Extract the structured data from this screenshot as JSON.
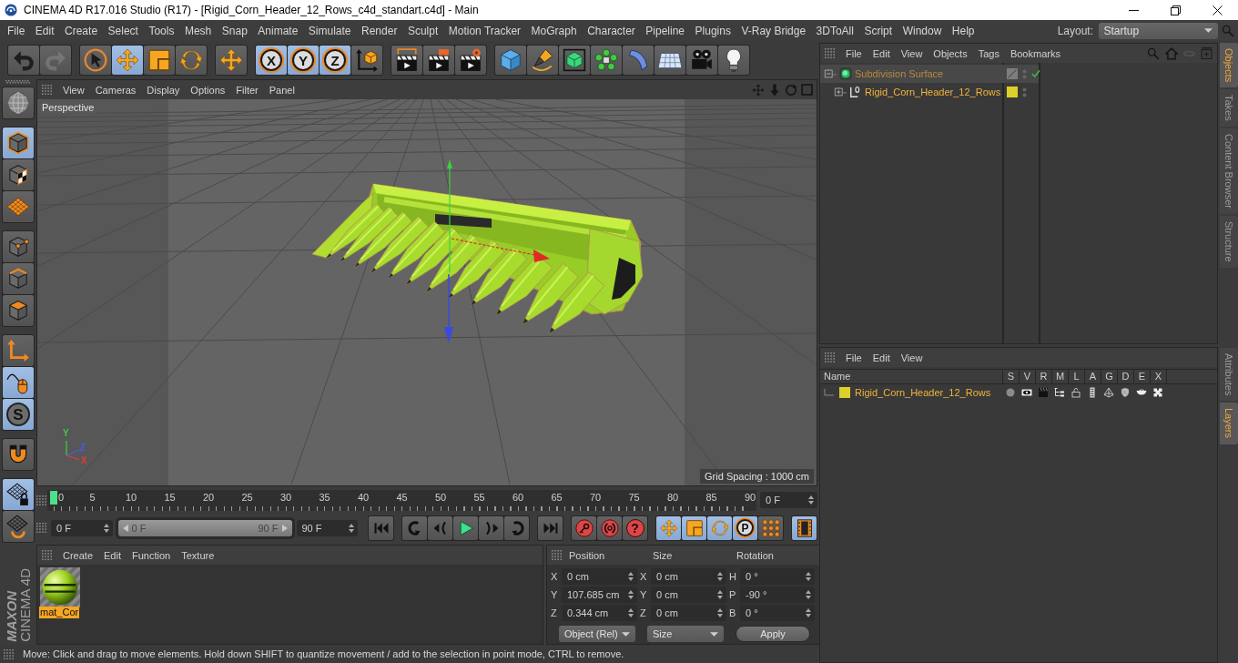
{
  "window": {
    "title": "CINEMA 4D R17.016 Studio (R17) - [Rigid_Corn_Header_12_Rows_c4d_standart.c4d] - Main"
  },
  "menu": [
    "File",
    "Edit",
    "Create",
    "Select",
    "Tools",
    "Mesh",
    "Snap",
    "Animate",
    "Simulate",
    "Render",
    "Sculpt",
    "Motion Tracker",
    "MoGraph",
    "Character",
    "Pipeline",
    "Plugins",
    "V-Ray Bridge",
    "3DToAll",
    "Script",
    "Window",
    "Help"
  ],
  "layout": {
    "label": "Layout:",
    "value": "Startup"
  },
  "toolbar": [
    [
      {
        "kind": "undo",
        "active": false,
        "disabled": false
      },
      {
        "kind": "redo",
        "active": false,
        "disabled": true
      }
    ],
    [
      {
        "kind": "pointer",
        "active": false,
        "disabled": false
      },
      {
        "kind": "move",
        "active": true,
        "disabled": false
      },
      {
        "kind": "scale",
        "active": false,
        "disabled": false
      },
      {
        "kind": "rotate",
        "active": false,
        "disabled": false
      }
    ],
    [
      {
        "kind": "recent",
        "active": false,
        "disabled": false
      }
    ],
    [
      {
        "kind": "axis",
        "label": "X",
        "active": true,
        "disabled": false
      },
      {
        "kind": "axis",
        "label": "Y",
        "active": true,
        "disabled": false
      },
      {
        "kind": "axis",
        "label": "Z",
        "active": true,
        "disabled": false
      },
      {
        "kind": "coords",
        "active": false,
        "disabled": false
      }
    ],
    [
      {
        "kind": "renderview",
        "active": false,
        "disabled": false
      },
      {
        "kind": "renderpicture",
        "active": false,
        "disabled": false
      },
      {
        "kind": "rendersettings",
        "active": false,
        "disabled": false
      }
    ],
    [
      {
        "kind": "cube",
        "active": false,
        "disabled": false
      },
      {
        "kind": "pen",
        "active": false,
        "disabled": false
      },
      {
        "kind": "subdivision",
        "active": false,
        "disabled": false
      },
      {
        "kind": "cloner",
        "active": false,
        "disabled": false
      },
      {
        "kind": "bend",
        "active": false,
        "disabled": false
      },
      {
        "kind": "floor",
        "active": false,
        "disabled": false
      },
      {
        "kind": "camera",
        "active": false,
        "disabled": false
      },
      {
        "kind": "light",
        "active": false,
        "disabled": false
      }
    ]
  ],
  "tools": [
    [
      {
        "kind": "editable",
        "active": false
      }
    ],
    [
      {
        "kind": "model",
        "active": true
      },
      {
        "kind": "texture",
        "active": false
      },
      {
        "kind": "workplane",
        "active": false
      }
    ],
    [
      {
        "kind": "points",
        "active": false
      },
      {
        "kind": "edges",
        "active": false
      },
      {
        "kind": "polygons",
        "active": false
      }
    ],
    [
      {
        "kind": "axismode",
        "active": false
      },
      {
        "kind": "tweak",
        "active": true
      },
      {
        "kind": "solo",
        "label": "S",
        "active": true
      }
    ],
    [
      {
        "kind": "magnet",
        "active": false
      }
    ],
    [
      {
        "kind": "lockplane",
        "active": true
      },
      {
        "kind": "planeorient",
        "active": false
      }
    ]
  ],
  "logo": {
    "brand": "MAXON",
    "product": "CINEMA 4D"
  },
  "viewport": {
    "menu": [
      "View",
      "Cameras",
      "Display",
      "Options",
      "Filter",
      "Panel"
    ],
    "camera": "Perspective",
    "grid_spacing": "Grid Spacing : 1000 cm",
    "axes": [
      {
        "label": "Y",
        "color": "#3cd03c"
      },
      {
        "label": "Z",
        "color": "#4a5ae8"
      },
      {
        "label": "X",
        "color": "#e83a3a"
      }
    ]
  },
  "timeline": {
    "ticks": [
      "0",
      "5",
      "10",
      "15",
      "20",
      "25",
      "30",
      "35",
      "40",
      "45",
      "50",
      "55",
      "60",
      "65",
      "70",
      "75",
      "80",
      "85",
      "90"
    ],
    "level": 0,
    "current": "0 F",
    "start": "0 F",
    "range": {
      "start": "0 F",
      "end": "90 F",
      "level": 1
    },
    "end": "90 F",
    "controls": [
      [
        {
          "kind": "first",
          "active": false
        }
      ],
      [
        {
          "kind": "prevkey",
          "active": false
        },
        {
          "kind": "prevframe",
          "active": false
        },
        {
          "kind": "play",
          "active": false
        },
        {
          "kind": "nextframe",
          "active": false
        },
        {
          "kind": "nextkey",
          "active": false
        }
      ],
      [
        {
          "kind": "last",
          "active": false
        }
      ],
      [
        {
          "kind": "record",
          "active": false
        },
        {
          "kind": "autokey",
          "active": false
        },
        {
          "kind": "keyselection",
          "label": "?",
          "active": false
        }
      ],
      [
        {
          "kind": "keymove",
          "active": true
        },
        {
          "kind": "keyscale",
          "active": true
        },
        {
          "kind": "keyrotate",
          "active": true
        },
        {
          "kind": "keyparam",
          "label": "P",
          "active": true
        },
        {
          "kind": "keypla",
          "active": false
        }
      ],
      [
        {
          "kind": "timelineview",
          "active": true
        }
      ]
    ]
  },
  "materials": {
    "menu": [
      "Create",
      "Edit",
      "Function",
      "Texture"
    ],
    "items": [
      {
        "name": "mat_Cor",
        "selected": true
      }
    ]
  },
  "coordinates": {
    "headers": [
      "Position",
      "Size",
      "Rotation"
    ],
    "rows": [
      [
        {
          "axis": "X",
          "value": "0 cm"
        },
        {
          "axis": "X",
          "value": "0 cm"
        },
        {
          "axis": "H",
          "value": "0 °"
        }
      ],
      [
        {
          "axis": "Y",
          "value": "107.685 cm"
        },
        {
          "axis": "Y",
          "value": "0 cm"
        },
        {
          "axis": "P",
          "value": "-90 °"
        }
      ],
      [
        {
          "axis": "Z",
          "value": "0.344 cm"
        },
        {
          "axis": "Z",
          "value": "0 cm"
        },
        {
          "axis": "B",
          "value": "0 °"
        }
      ]
    ],
    "mode": "Object (Rel)",
    "size_mode": "Size",
    "apply": "Apply"
  },
  "status_bar": "Move: Click and drag to move elements. Hold down SHIFT to quantize movement / add to the selection in point mode, CTRL to remove.",
  "objects": {
    "menu": [
      "File",
      "Edit",
      "View",
      "Objects",
      "Tags",
      "Bookmarks"
    ],
    "tree": [
      {
        "name": "Subdivision Surface",
        "kind": "subdivision",
        "selected": true,
        "active": true,
        "expanded": true,
        "enabled": true,
        "children": [
          {
            "name": "Rigid_Corn_Header_12_Rows",
            "kind": "null",
            "selected": true,
            "active": false,
            "expanded": false,
            "enabled": false,
            "color": "#dcd02a"
          }
        ]
      }
    ]
  },
  "layers": {
    "menu": [
      "File",
      "Edit",
      "View"
    ],
    "name_header": "Name",
    "columns": [
      {
        "label": "S",
        "kind": "solo"
      },
      {
        "label": "V",
        "kind": "view"
      },
      {
        "label": "R",
        "kind": "render"
      },
      {
        "label": "M",
        "kind": "manager"
      },
      {
        "label": "L",
        "kind": "lock"
      },
      {
        "label": "A",
        "kind": "animation"
      },
      {
        "label": "G",
        "kind": "generators"
      },
      {
        "label": "D",
        "kind": "deformers"
      },
      {
        "label": "E",
        "kind": "expressions"
      },
      {
        "label": "X",
        "kind": "xrefs"
      }
    ],
    "rows": [
      {
        "name": "Rigid_Corn_Header_12_Rows",
        "color": "#dcd02a",
        "selected": true
      }
    ]
  },
  "side_tabs": {
    "top": [
      {
        "label": "Objects",
        "selected": true
      },
      {
        "label": "Takes",
        "selected": false
      },
      {
        "label": "Content Browser",
        "selected": false
      },
      {
        "label": "Structure",
        "selected": false
      }
    ],
    "bottom": [
      {
        "label": "Attributes",
        "selected": false
      },
      {
        "label": "Layers",
        "selected": true
      }
    ]
  }
}
